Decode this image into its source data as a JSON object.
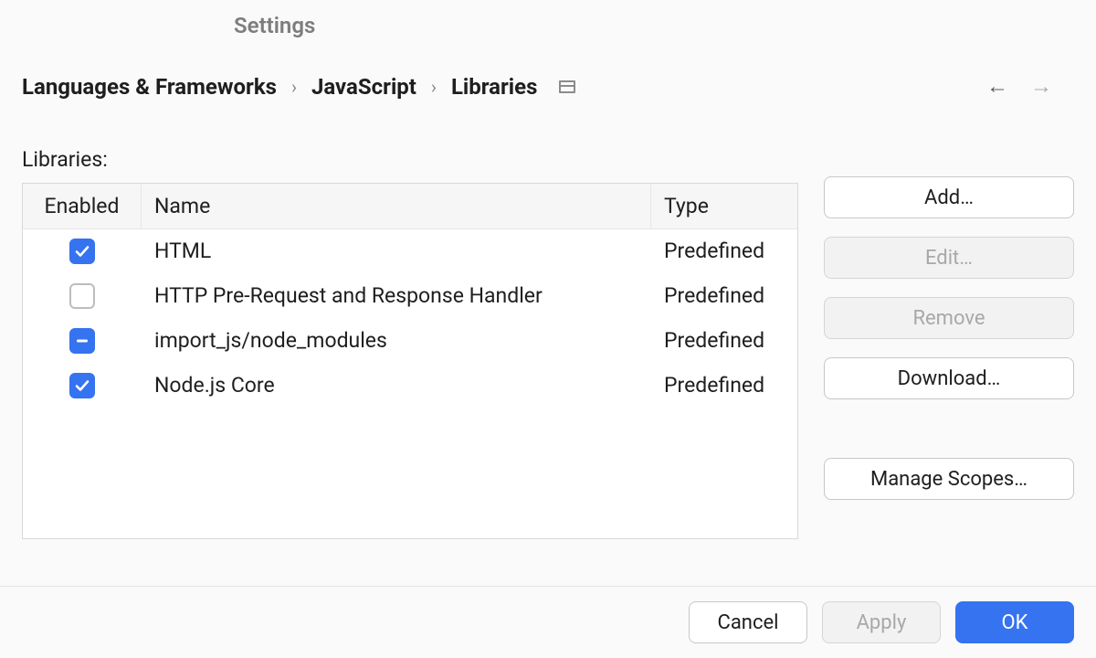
{
  "title": "Settings",
  "breadcrumb": {
    "level1": "Languages & Frameworks",
    "level2": "JavaScript",
    "level3": "Libraries"
  },
  "section_label": "Libraries:",
  "columns": {
    "enabled": "Enabled",
    "name": "Name",
    "type": "Type"
  },
  "rows": [
    {
      "state": "checked",
      "name": "HTML",
      "type": "Predefined"
    },
    {
      "state": "unchecked",
      "name": "HTTP Pre-Request and Response Handler",
      "type": "Predefined"
    },
    {
      "state": "indeterminate",
      "name": "import_js/node_modules",
      "type": "Predefined"
    },
    {
      "state": "checked",
      "name": "Node.js Core",
      "type": "Predefined"
    }
  ],
  "side_buttons": {
    "add": "Add…",
    "edit": "Edit…",
    "remove": "Remove",
    "download": "Download…",
    "manage_scopes": "Manage Scopes…"
  },
  "footer": {
    "cancel": "Cancel",
    "apply": "Apply",
    "ok": "OK"
  }
}
